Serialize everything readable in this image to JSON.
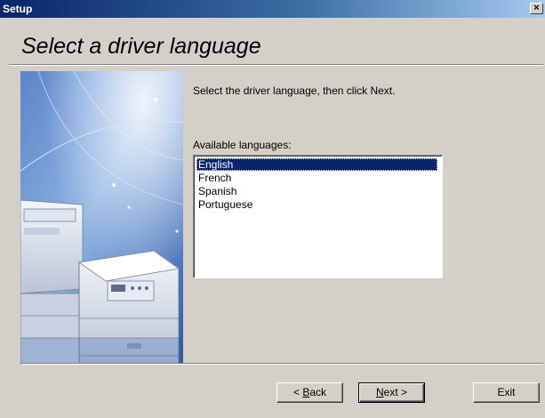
{
  "window": {
    "title": "Setup",
    "close_glyph": "×"
  },
  "page": {
    "heading": "Select a driver language",
    "instruction": "Select the driver language, then click Next.",
    "list_label": "Available languages:"
  },
  "languages": {
    "items": [
      "English",
      "French",
      "Spanish",
      "Portuguese"
    ],
    "selected": "English"
  },
  "buttons": {
    "back": {
      "prefix": "< ",
      "mnemonic": "B",
      "rest": "ack"
    },
    "next": {
      "mnemonic": "N",
      "rest": "ext >"
    },
    "exit": "Exit"
  },
  "colors": {
    "title_bar_start": "#0a246a",
    "title_bar_end": "#a6caf0",
    "selection": "#0a246a",
    "dialog_face": "#d4d0c8"
  },
  "icons": {
    "close": "close-icon",
    "side_art": "printer-illustration"
  }
}
